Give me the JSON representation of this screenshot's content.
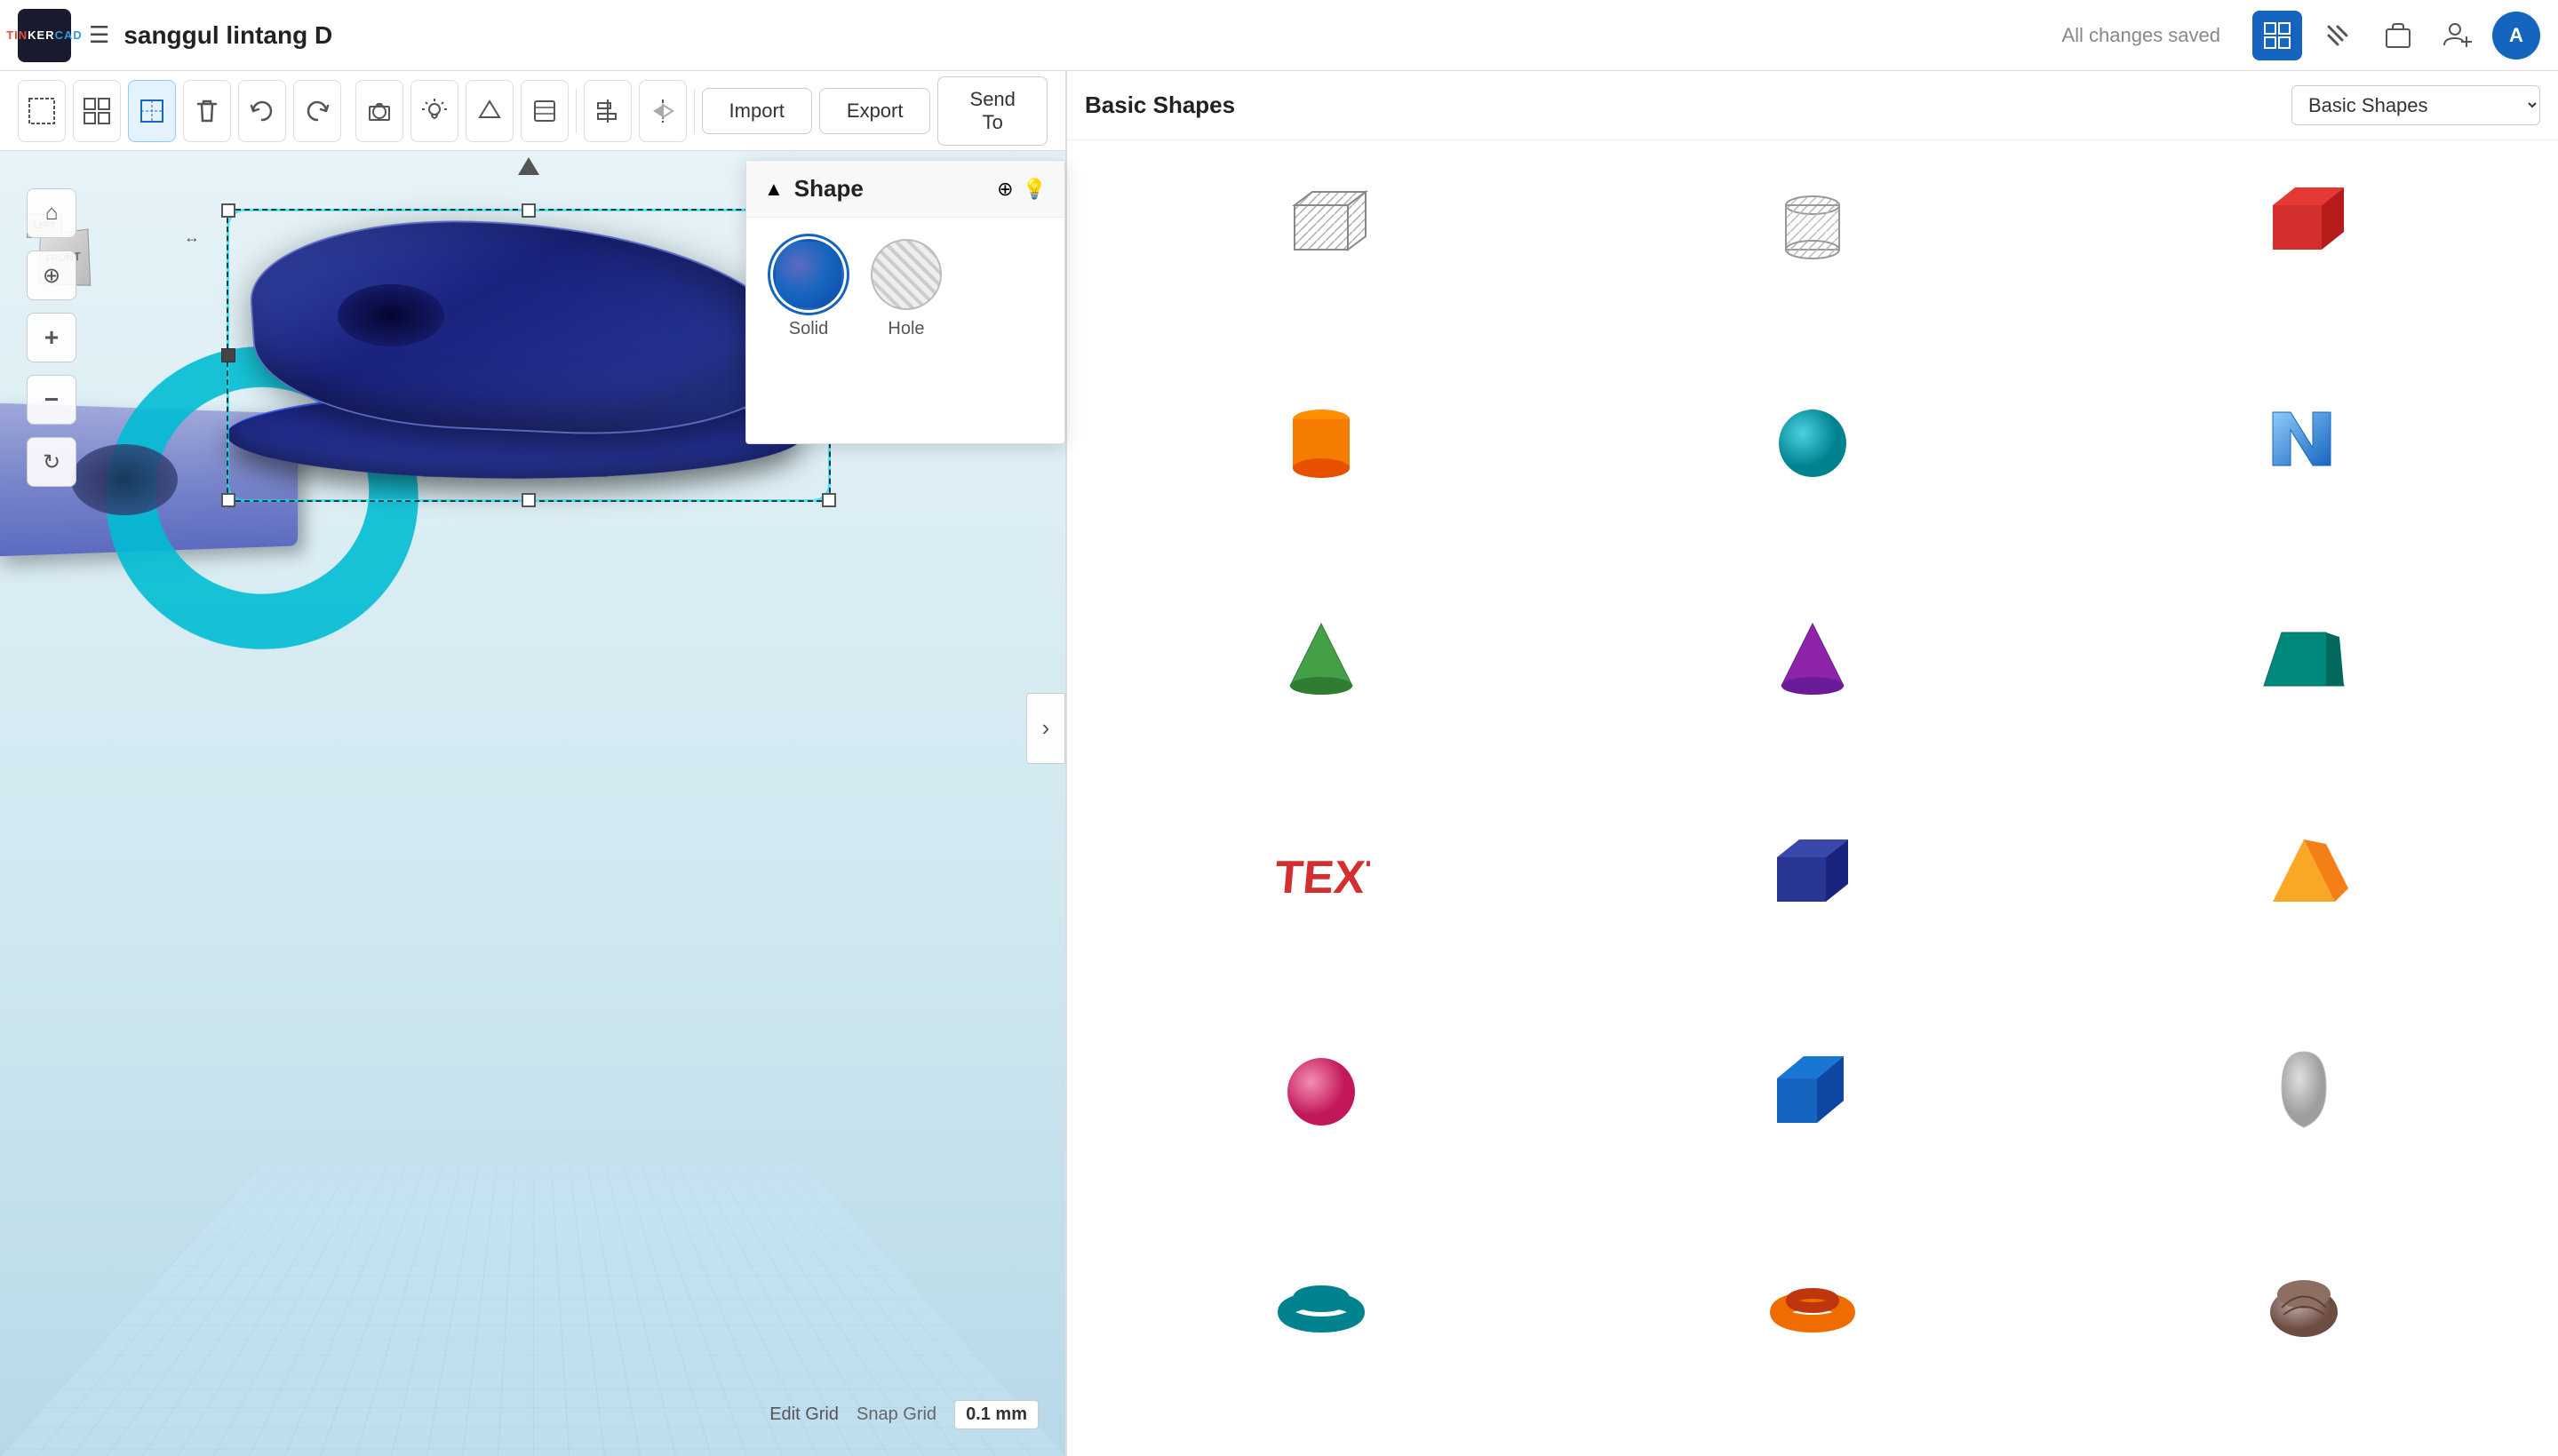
{
  "app": {
    "logo_lines": [
      "TIN",
      "KER",
      "CAD"
    ],
    "doc_title": "sanggul lintang D",
    "save_status": "All changes saved"
  },
  "toolbar": {
    "tools": [
      {
        "name": "select-box",
        "icon": "⬜",
        "label": "Select Box"
      },
      {
        "name": "group",
        "icon": "❑",
        "label": "Group"
      },
      {
        "name": "ungroup",
        "icon": "⊠",
        "label": "Ungroup"
      },
      {
        "name": "delete",
        "icon": "🗑",
        "label": "Delete"
      },
      {
        "name": "undo",
        "icon": "↩",
        "label": "Undo"
      },
      {
        "name": "redo",
        "icon": "↪",
        "label": "Redo"
      }
    ]
  },
  "right_toolbar": {
    "tools": [
      {
        "name": "view-camera",
        "icon": "📷",
        "label": "Camera"
      },
      {
        "name": "toggle-light",
        "icon": "💡",
        "label": "Light"
      },
      {
        "name": "geometry",
        "icon": "◇",
        "label": "Geometry"
      },
      {
        "name": "layers",
        "icon": "⧉",
        "label": "Layers"
      },
      {
        "name": "align",
        "icon": "⊟",
        "label": "Align"
      },
      {
        "name": "mirror",
        "icon": "⟺",
        "label": "Mirror"
      }
    ],
    "import_label": "Import",
    "export_label": "Export",
    "send_to_label": "Send To"
  },
  "nav_right": {
    "grid_icon": "⊞",
    "hammer_icon": "🔨",
    "briefcase_icon": "💼",
    "add_user_icon": "👤+",
    "avatar_letter": "A"
  },
  "shape_panel": {
    "title": "Shape",
    "solid_label": "Solid",
    "hole_label": "Hole",
    "save_icon": "💾",
    "bulb_icon": "💡"
  },
  "shapes_panel": {
    "category_label": "Basic Shapes",
    "category_select_value": "Basic Shapes",
    "shapes": [
      {
        "name": "box-hatched",
        "color": "#aaa",
        "type": "box-hatched"
      },
      {
        "name": "cylinder-hatched",
        "color": "#bbb",
        "type": "cyl-hatched"
      },
      {
        "name": "red-box",
        "color": "#d32f2f",
        "type": "box-solid"
      },
      {
        "name": "orange-cylinder",
        "color": "#f57c00",
        "type": "cyl-solid"
      },
      {
        "name": "blue-sphere",
        "color": "#0097a7",
        "type": "sphere"
      },
      {
        "name": "blue-n-shape",
        "color": "#1565c0",
        "type": "n-shape"
      },
      {
        "name": "green-pyramid",
        "color": "#388e3c",
        "type": "pyramid"
      },
      {
        "name": "purple-pyramid",
        "color": "#7b1fa2",
        "type": "pyramid-s"
      },
      {
        "name": "teal-shape",
        "color": "#00897b",
        "type": "trapezoid"
      },
      {
        "name": "text-3d",
        "color": "#d32f2f",
        "type": "text"
      },
      {
        "name": "dark-box",
        "color": "#1a237e",
        "type": "box-dark"
      },
      {
        "name": "yellow-pyramid",
        "color": "#f9a825",
        "type": "pyramid-y"
      },
      {
        "name": "pink-sphere",
        "color": "#e91e63",
        "type": "sphere-pink"
      },
      {
        "name": "navy-cube",
        "color": "#1565c0",
        "type": "cube-navy"
      },
      {
        "name": "teardrop",
        "color": "#bbb",
        "type": "teardrop"
      },
      {
        "name": "torus",
        "color": "#0097a7",
        "type": "torus"
      },
      {
        "name": "donut-orange",
        "color": "#ef6c00",
        "type": "torus-orange"
      },
      {
        "name": "walnut",
        "color": "#8d6e63",
        "type": "walnut"
      }
    ]
  },
  "viewport": {
    "edit_grid_label": "Edit Grid",
    "snap_grid_label": "Snap Grid",
    "snap_grid_value": "0.1 mm"
  },
  "orient_cube": {
    "left_label": "LEFT",
    "front_label": "FRONT"
  }
}
